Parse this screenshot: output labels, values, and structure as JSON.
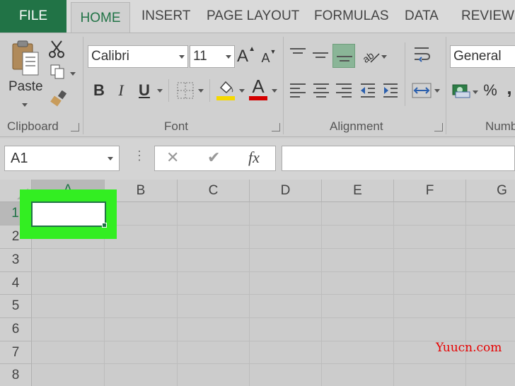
{
  "tabs": {
    "file": "FILE",
    "home": "HOME",
    "insert": "INSERT",
    "page_layout": "PAGE LAYOUT",
    "formulas": "FORMULAS",
    "data": "DATA",
    "review": "REVIEW"
  },
  "clipboard": {
    "paste_label": "Paste",
    "group_label": "Clipboard"
  },
  "font": {
    "family": "Calibri",
    "size": "11",
    "grow_label": "A",
    "shrink_label": "A",
    "bold": "B",
    "italic": "I",
    "underline": "U",
    "color_label": "A",
    "highlight_color": "#f5d800",
    "text_color": "#d40000",
    "group_label": "Font"
  },
  "alignment": {
    "group_label": "Alignment"
  },
  "number": {
    "format": "General",
    "percent": "%",
    "comma": ",",
    "group_label": "Numb"
  },
  "formula_bar": {
    "name_box": "A1",
    "cancel": "✕",
    "enter": "✔",
    "fx": "fx",
    "more": "⋮"
  },
  "columns": [
    "A",
    "B",
    "C",
    "D",
    "E",
    "F",
    "G"
  ],
  "rows": [
    "1",
    "2",
    "3",
    "4",
    "5",
    "6",
    "7",
    "8"
  ],
  "accent_color": "#217346",
  "watermark": "Yuucn.com"
}
